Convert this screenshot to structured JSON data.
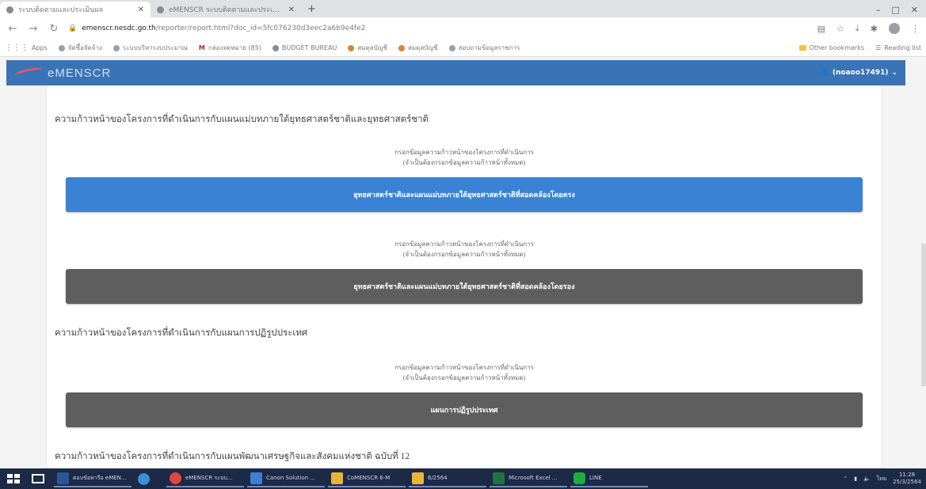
{
  "browser": {
    "tabs": [
      {
        "title": "ระบบติดตามและประเมินผล",
        "active": true
      },
      {
        "title": "eMENSCR ระบบติดตามและประเมินผล",
        "active": false
      }
    ],
    "new_tab_icon": "+",
    "window_controls": [
      "–",
      "□",
      "✕"
    ],
    "url_host": "emenscr.nesdc.go.th",
    "url_path": "/reporter/report.html?doc_id=5fc076230d3eec2a6b9e4fe2",
    "bookmarks": [
      {
        "label": "Apps",
        "icon": "apps-grid-icon"
      },
      {
        "label": "จัดซื้อจัดจ้าง",
        "icon": "globe-icon"
      },
      {
        "label": "ระบบบริหารงบประมาณ",
        "icon": "globe-icon"
      },
      {
        "label": "กล่องจดหมาย (85)",
        "icon": "gmail-icon"
      },
      {
        "label": "BUDGET BUREAU",
        "icon": "globe-icon"
      },
      {
        "label": "สมดุลบัญชี",
        "icon": "orange-dot-icon"
      },
      {
        "label": "สมดุลบัญชี",
        "icon": "orange-dot-icon"
      },
      {
        "label": "สอบถามข้อมูลราชการ",
        "icon": "globe-icon"
      }
    ],
    "other_bookmarks": "Other bookmarks",
    "reading_list": "Reading list"
  },
  "app": {
    "logo": "eMENSCR",
    "user": "(noaoo17491)"
  },
  "sections": [
    {
      "title": "ความก้าวหน้าของโครงการที่ดำเนินการกับแผนแม่บทภายใต้ยุทธศาสตร์ชาติและยุทธศาสตร์ชาติ",
      "groups": [
        {
          "hint_line1": "กรอกข้อมูลความก้าวหน้าของโครงการที่ดำเนินการ",
          "hint_line2": "(จำเป็นต้องกรอกข้อมูลความก้าวหน้าทั้งหมด)",
          "button": "ยุทธศาสตร์ชาติและแผนแม่บทภายใต้ยุทธศาสตร์ชาติที่สอดคล้องโดยตรง",
          "style": "blue"
        },
        {
          "hint_line1": "กรอกข้อมูลความก้าวหน้าของโครงการที่ดำเนินการ",
          "hint_line2": "(จำเป็นต้องกรอกข้อมูลความก้าวหน้าทั้งหมด)",
          "button": "ยุทธศาสตร์ชาติและแผนแม่บทภายใต้ยุทธศาสตร์ชาติที่สอดคล้องโดยรอง",
          "style": "gray"
        }
      ]
    },
    {
      "title": "ความก้าวหน้าของโครงการที่ดำเนินการกับแผนการปฏิรูปประเทศ",
      "groups": [
        {
          "hint_line1": "กรอกข้อมูลความก้าวหน้าของโครงการที่ดำเนินการ",
          "hint_line2": "(จำเป็นต้องกรอกข้อมูลความก้าวหน้าทั้งหมด)",
          "button": "แผนการปฏิรูปประเทศ",
          "style": "gray"
        }
      ]
    },
    {
      "title": "ความก้าวหน้าของโครงการที่ดำเนินการกับแผนพัฒนาเศรษฐกิจและสังคมแห่งชาติ ฉบับที่ 12",
      "groups": []
    }
  ],
  "taskbar": {
    "items": [
      {
        "label": "ตอบข้อหารือ eMEN...",
        "icon": "word-icon",
        "color": "#2b5797"
      },
      {
        "label": "",
        "icon": "edge-icon",
        "color": "#3a8fd8"
      },
      {
        "label": "eMENSCR ระบบ...",
        "icon": "chrome-icon",
        "color": "#e0483b"
      },
      {
        "label": "Canon Solution ...",
        "icon": "canon-icon",
        "color": "#3f7fd0"
      },
      {
        "label": "CoMENSCR 6-M",
        "icon": "folder-icon",
        "color": "#e8b53a"
      },
      {
        "label": "6/2564",
        "icon": "folder-icon",
        "color": "#e8b53a"
      },
      {
        "label": "Microsoft Excel ...",
        "icon": "excel-icon",
        "color": "#217346"
      },
      {
        "label": "LINE",
        "icon": "line-icon",
        "color": "#1fae3b"
      }
    ],
    "clock_time": "11:28",
    "clock_date": "25/3/2564",
    "lang": "ไทย"
  }
}
